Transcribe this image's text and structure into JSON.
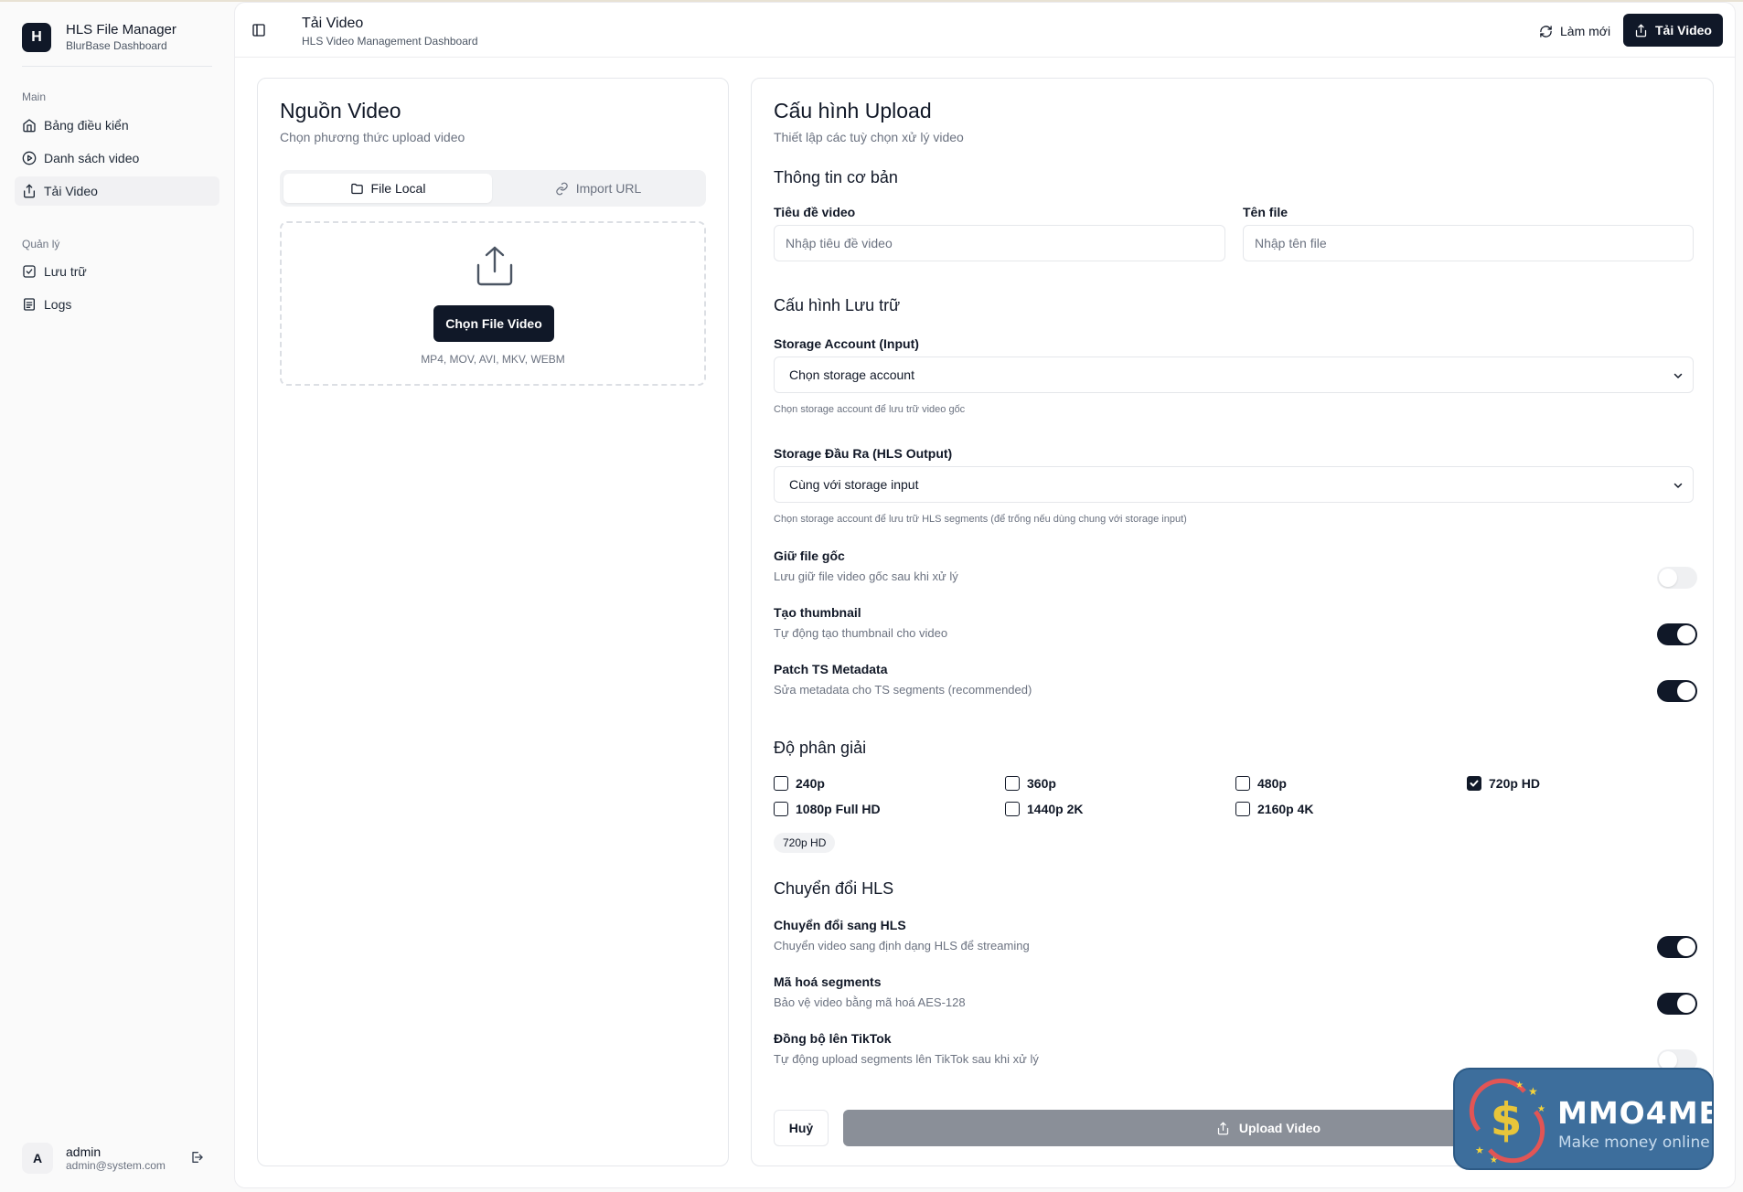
{
  "brand": {
    "logo_letter": "H",
    "title": "HLS File Manager",
    "subtitle": "BlurBase Dashboard"
  },
  "sidebar": {
    "group_main": "Main",
    "main_items": [
      {
        "label": "Bảng điều kiển",
        "icon": "home-icon"
      },
      {
        "label": "Danh sách video",
        "icon": "play-circle-icon"
      },
      {
        "label": "Tải Video",
        "icon": "upload-icon",
        "active": true
      }
    ],
    "group_manage": "Quản lý",
    "manage_items": [
      {
        "label": "Lưu trữ",
        "icon": "storage-icon"
      },
      {
        "label": "Logs",
        "icon": "file-text-icon"
      }
    ]
  },
  "user": {
    "initial": "A",
    "name": "admin",
    "email": "admin@system.com"
  },
  "header": {
    "title": "Tải Video",
    "subtitle": "HLS Video Management Dashboard",
    "refresh_label": "Làm mới",
    "upload_label": "Tải Video"
  },
  "source": {
    "title": "Nguồn Video",
    "subtitle": "Chọn phương thức upload video",
    "tab_local": "File Local",
    "tab_url": "Import URL",
    "choose_label": "Chọn File Video",
    "formats": "MP4, MOV, AVI, MKV, WEBM"
  },
  "config": {
    "title": "Cấu hình Upload",
    "subtitle": "Thiết lập các tuỳ chọn xử lý video",
    "basic_section": "Thông tin cơ bản",
    "video_title_label": "Tiêu đề video",
    "video_title_placeholder": "Nhập tiêu đề video",
    "file_name_label": "Tên file",
    "file_name_placeholder": "Nhập tên file",
    "storage_section": "Cấu hình Lưu trữ",
    "storage_input_label": "Storage Account (Input)",
    "storage_input_value": "Chọn storage account",
    "storage_input_hint": "Chọn storage account để lưu trữ video gốc",
    "storage_output_label": "Storage Đầu Ra (HLS Output)",
    "storage_output_value": "Cùng với storage input",
    "storage_output_hint": "Chọn storage account để lưu trữ HLS segments (để trống nếu dùng chung với storage input)",
    "options": [
      {
        "title": "Giữ file gốc",
        "desc": "Lưu giữ file video gốc sau khi xử lý",
        "on": false
      },
      {
        "title": "Tạo thumbnail",
        "desc": "Tự động tạo thumbnail cho video",
        "on": true
      },
      {
        "title": "Patch TS Metadata",
        "desc": "Sửa metadata cho TS segments (recommended)",
        "on": true
      }
    ],
    "resolution_section": "Độ phân giải",
    "resolutions": [
      {
        "label": "240p",
        "checked": false
      },
      {
        "label": "360p",
        "checked": false
      },
      {
        "label": "480p",
        "checked": false
      },
      {
        "label": "720p HD",
        "checked": true
      },
      {
        "label": "1080p Full HD",
        "checked": false
      },
      {
        "label": "1440p 2K",
        "checked": false
      },
      {
        "label": "2160p 4K",
        "checked": false
      }
    ],
    "selected_badge": "720p HD",
    "hls_section": "Chuyển đổi HLS",
    "hls_options": [
      {
        "title": "Chuyển đổi sang HLS",
        "desc": "Chuyển video sang định dạng HLS để streaming",
        "on": true
      },
      {
        "title": "Mã hoá segments",
        "desc": "Bảo vệ video bằng mã hoá AES-128",
        "on": true
      },
      {
        "title": "Đồng bộ lên TikTok",
        "desc": "Tự động upload segments lên TikTok sau khi xử lý",
        "on": false
      }
    ],
    "cancel_label": "Huỷ",
    "submit_label": "Upload Video"
  },
  "watermark": {
    "title": "MMO4ME",
    "tagline": "Make money online"
  }
}
